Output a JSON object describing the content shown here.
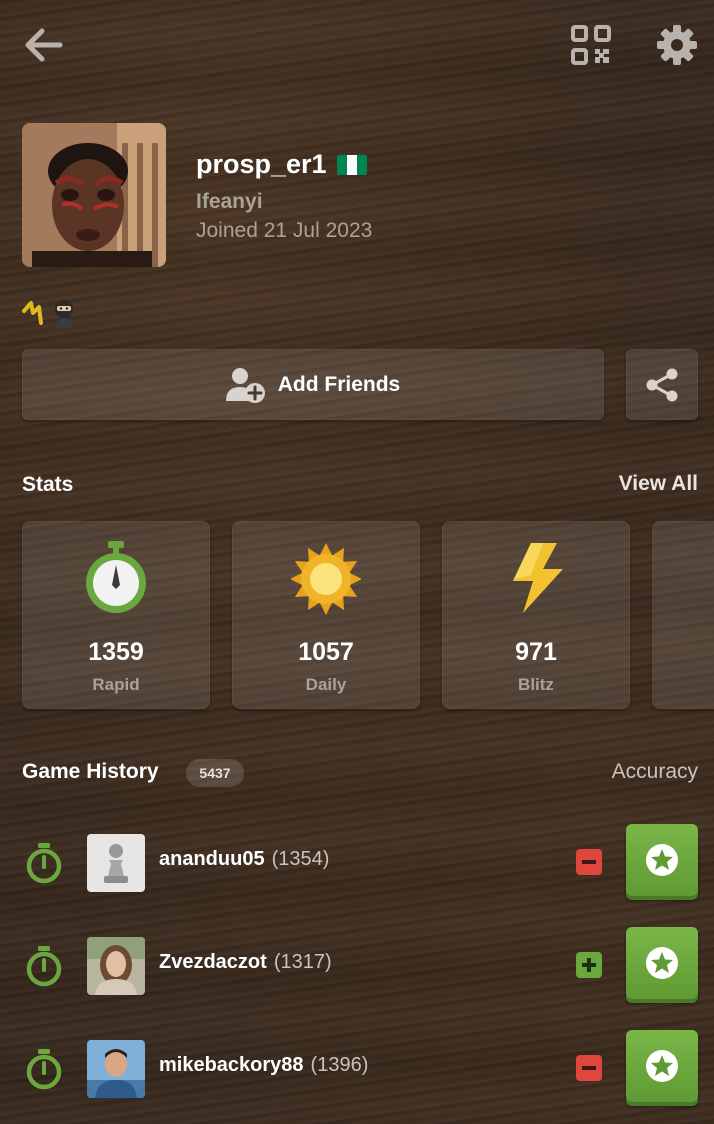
{
  "profile": {
    "username": "prosp_er1",
    "real_name": "Ifeanyi",
    "joined": "Joined 21 Jul 2023",
    "flag_country": "Nigeria",
    "flag_colors": [
      "#008751",
      "#ffffff",
      "#008751"
    ],
    "status_emojis": [
      "zigzag-emoji",
      "ninja-emoji"
    ]
  },
  "actions": {
    "add_friends_label": "Add Friends"
  },
  "stats": {
    "title": "Stats",
    "view_all": "View All",
    "cards": [
      {
        "value": "1359",
        "label": "Rapid",
        "icon": "stopwatch-icon"
      },
      {
        "value": "1057",
        "label": "Daily",
        "icon": "sun-icon"
      },
      {
        "value": "971",
        "label": "Blitz",
        "icon": "lightning-icon"
      }
    ]
  },
  "game_history": {
    "title": "Game History",
    "count": "5437",
    "accuracy_label": "Accuracy",
    "games": [
      {
        "opponent": "ananduu05",
        "rating": "(1354)",
        "result": "loss",
        "avatar": "pawn-avatar"
      },
      {
        "opponent": "Zvezdaczot",
        "rating": "(1317)",
        "result": "win",
        "avatar": "photo-avatar"
      },
      {
        "opponent": "mikebackory88",
        "rating": "(1396)",
        "result": "loss",
        "avatar": "photo-avatar"
      }
    ]
  },
  "colors": {
    "accent_green": "#7ab648",
    "loss_red": "#e0463b",
    "win_green": "#6aa83f",
    "muted_text": "#a9a29b"
  }
}
